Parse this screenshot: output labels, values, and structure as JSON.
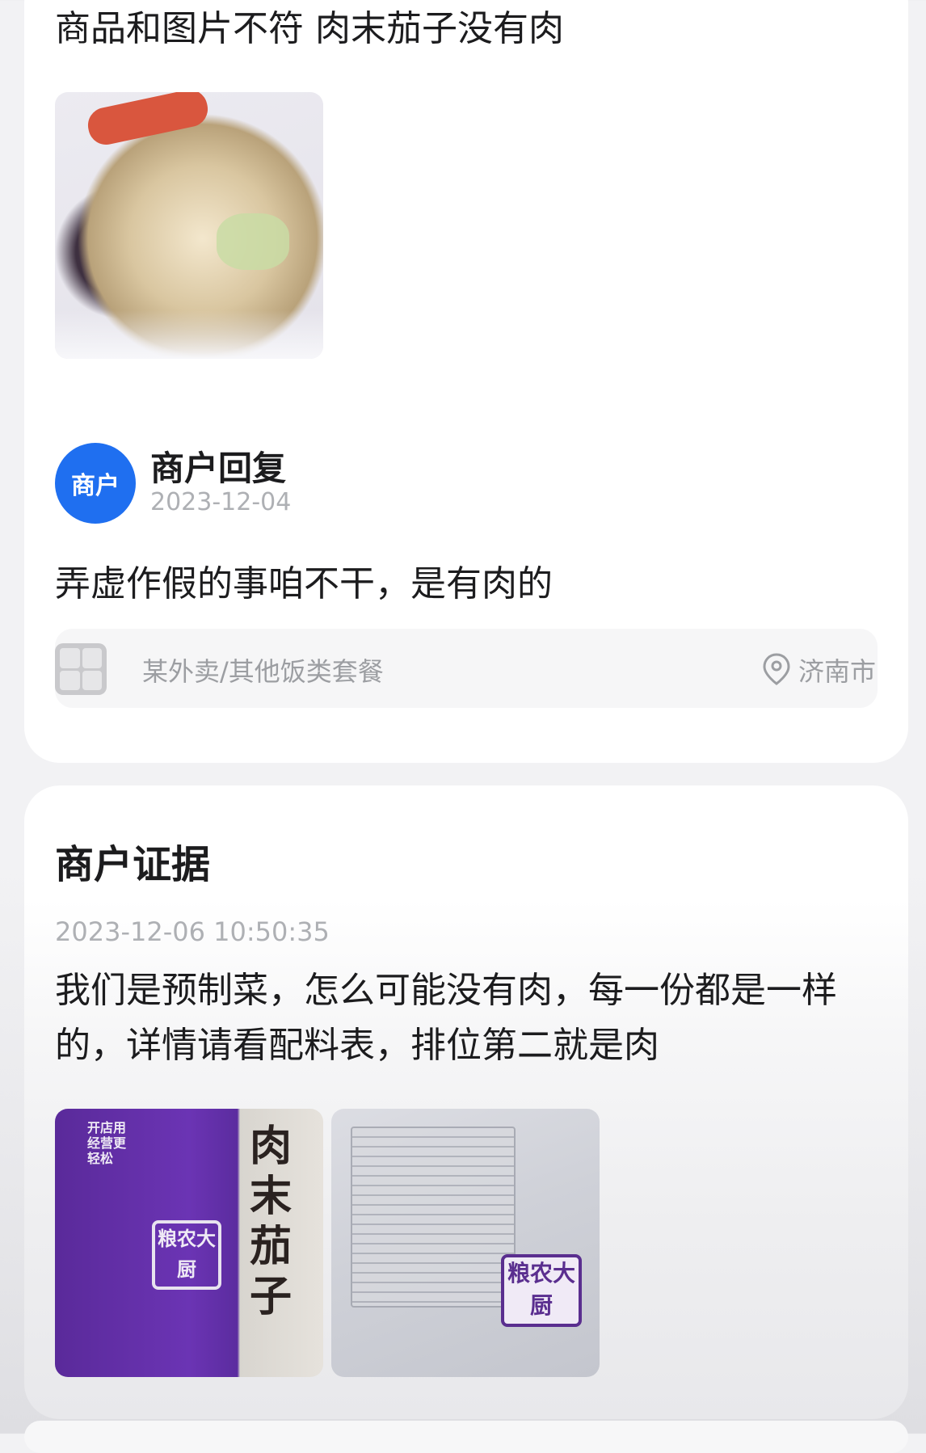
{
  "review": {
    "text": "商品和图片不符 肉末茄子没有肉",
    "photo_icon": "food-bowl-photo"
  },
  "merchant_reply": {
    "avatar_label": "商户",
    "title": "商户回复",
    "date": "2023-12-04",
    "text": "弄虚作假的事咱不干，是有肉的"
  },
  "shop_bar": {
    "shop_name": "某外卖/其他饭类套餐",
    "location_icon": "location-pin-icon",
    "location": "济南市"
  },
  "merchant_evidence": {
    "title": "商户证据",
    "timestamp": "2023-12-06 10:50:35",
    "text": "我们是预制菜，怎么可能没有肉，每一份都是一样的，详情请看配料表，排位第二就是肉",
    "photo1": {
      "product_name": "肉末茄子",
      "brand": "粮农大厨",
      "side_text": "开店用 经营更轻松"
    },
    "photo2": {
      "brand": "粮农大厨"
    }
  },
  "colors": {
    "avatar_bg": "#1f6ff0",
    "muted_text": "#aeb0b4",
    "card_bg": "#ffffff",
    "page_bg": "#f2f2f4"
  }
}
